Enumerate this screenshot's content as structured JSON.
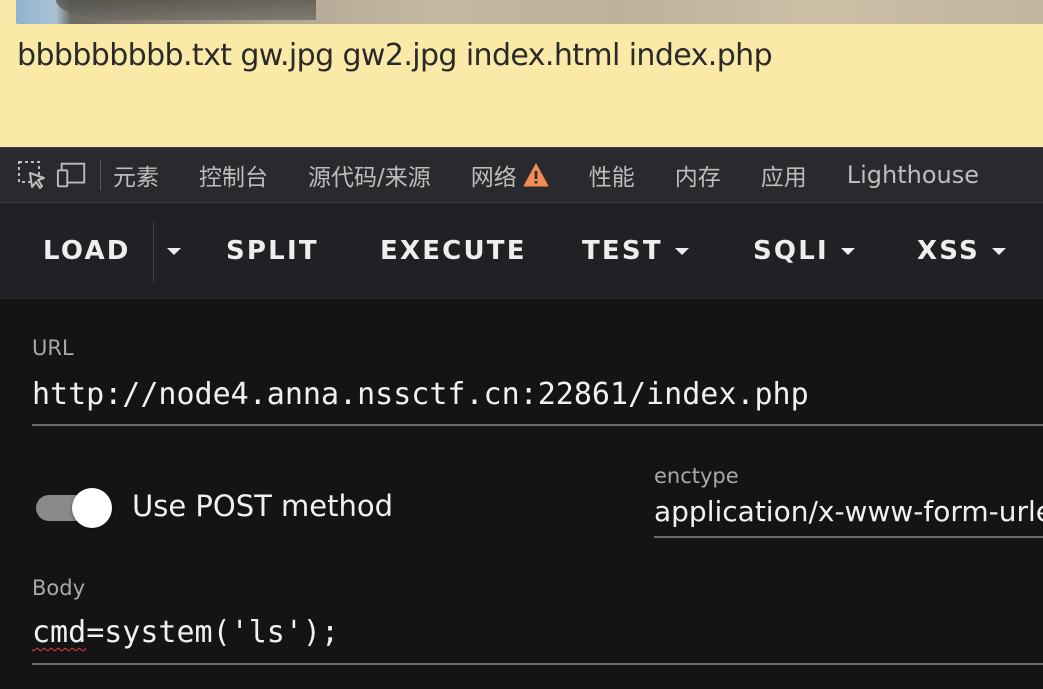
{
  "webpage": {
    "directory_listing": "bbbbbbbbb.txt gw.jpg gw2.jpg index.html index.php"
  },
  "devtools": {
    "tabs": [
      {
        "label": "元素"
      },
      {
        "label": "控制台"
      },
      {
        "label": "源代码/来源"
      },
      {
        "label": "网络",
        "warning": true
      },
      {
        "label": "性能"
      },
      {
        "label": "内存"
      },
      {
        "label": "应用"
      },
      {
        "label": "Lighthouse"
      }
    ],
    "icons": [
      "inspect-element-icon",
      "device-toolbar-icon",
      "warning-icon"
    ]
  },
  "hackbar": {
    "load_label": "LOAD",
    "split_label": "SPLIT",
    "execute_label": "EXECUTE",
    "test_label": "TEST",
    "sqli_label": "SQLI",
    "xss_label": "XSS"
  },
  "form": {
    "url_label": "URL",
    "url_value": "http://node4.anna.nssctf.cn:22861/index.php",
    "post_toggle_label": "Use POST method",
    "post_enabled": true,
    "enctype_label": "enctype",
    "enctype_value": "application/x-www-form-urlencoded",
    "body_label": "Body",
    "body_key": "cmd",
    "body_rest": "=system('ls');"
  },
  "colors": {
    "page_background": "#fbe9a7",
    "devtools_tabbar": "#292a2d",
    "hackbar_background": "#202124",
    "form_background": "#141414",
    "warning": "#f28b54"
  }
}
